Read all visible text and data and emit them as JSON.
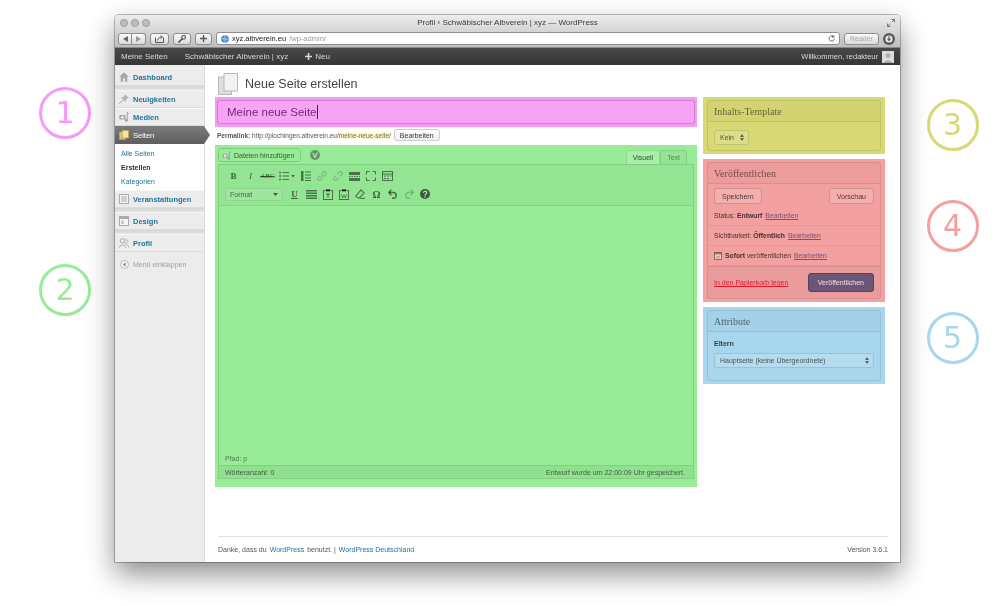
{
  "browser": {
    "title": "Profil ‹ Schwäbischer Albverein | xyz — WordPress",
    "url_host": "xyz.albverein.eu",
    "url_path": "/wp-admin/",
    "reader": {
      "label": "Reader",
      "disabled": true
    }
  },
  "admin_bar": {
    "items": [
      {
        "kind": "link",
        "label": "Meine Seiten"
      },
      {
        "kind": "link",
        "label": "Schwäbischer Albverein | xyz"
      },
      {
        "kind": "new",
        "label": "Neu"
      }
    ],
    "greeting": "Willkommen, redakteur"
  },
  "sidebar": {
    "groups": [
      [
        {
          "label": "Dashboard",
          "selected": false
        }
      ],
      [
        {
          "label": "Neuigkeiten",
          "selected": false
        },
        {
          "label": "Medien",
          "selected": false
        },
        {
          "label": "Seiten",
          "selected": true,
          "children": [
            {
              "label": "Alle Seiten",
              "selected": false
            },
            {
              "label": "Erstellen",
              "selected": true
            },
            {
              "label": "Kategorien",
              "selected": false
            }
          ]
        },
        {
          "label": "Veranstaltungen",
          "selected": false
        }
      ],
      [
        {
          "label": "Design",
          "selected": false
        }
      ],
      [
        {
          "label": "Profil",
          "selected": false
        }
      ]
    ],
    "collapse": "Menü einklappen"
  },
  "page": {
    "heading": "Neue Seite erstellen",
    "title_value": "Meine neue Seite",
    "permalink": {
      "text": "**Permalink:** http://plochingen.albverein.eu/",
      "slug": "meine-neue-seite/",
      "button": "Bearbeiten"
    }
  },
  "editor": {
    "add_media": "Dateien hinzufügen",
    "tabs": [
      {
        "label": "Visuell",
        "selected": true
      },
      {
        "label": "Text",
        "selected": false
      }
    ],
    "toolbar": [
      [
        {
          "kind": "glyph",
          "label": "B",
          "disabled": false
        },
        {
          "kind": "glyph",
          "label": "I",
          "disabled": false
        },
        {
          "kind": "glyph",
          "label": "ABC",
          "disabled": false
        },
        {
          "kind": "icon",
          "disabled": false
        },
        {
          "kind": "icon",
          "disabled": false
        },
        {
          "kind": "icon",
          "disabled": true
        },
        {
          "kind": "icon",
          "disabled": true
        },
        {
          "kind": "icon",
          "disabled": false
        },
        {
          "kind": "icon",
          "disabled": false
        },
        {
          "kind": "icon",
          "disabled": false
        }
      ],
      [
        {
          "kind": "select",
          "label": "Format",
          "disabled": false
        },
        {
          "kind": "glyph",
          "label": "U",
          "disabled": false
        },
        {
          "kind": "icon",
          "disabled": false
        },
        {
          "kind": "icon",
          "disabled": false
        },
        {
          "kind": "icon",
          "disabled": false
        },
        {
          "kind": "icon",
          "disabled": false
        },
        {
          "kind": "glyph",
          "label": "Ω",
          "disabled": false
        },
        {
          "kind": "icon",
          "disabled": false
        },
        {
          "kind": "icon",
          "disabled": true
        },
        {
          "kind": "icon",
          "disabled": false
        }
      ]
    ],
    "path": "Pfad: p",
    "word_count": "Wörteranzahl: 0",
    "autosave": "Entwurf wurde um 22:00:09 Uhr gespeichert."
  },
  "template_box": {
    "title": "Inhalts-Template",
    "select": "Kein"
  },
  "publish_box": {
    "title": "Veröffentlichen",
    "save": "Speichern",
    "preview": "Vorschau",
    "rows": [
      {
        "kind": "text",
        "text": "Status: **Entwurf**",
        "link": "Bearbeiten"
      },
      {
        "kind": "text",
        "text": "Sichtbarkeit: **Öffentlich**",
        "link": "Bearbeiten"
      },
      {
        "kind": "schedule",
        "text": "**Sofort** veröffentlichen",
        "link": "Bearbeiten"
      }
    ],
    "trash": "In den Papierkorb legen",
    "publish": "Veröffentlichen"
  },
  "attributes_box": {
    "title": "Attribute",
    "label": "Eltern",
    "select": "Hauptseite (keine Übergeordnete)"
  },
  "footer": {
    "parts": [
      {
        "kind": "text",
        "text": "Danke, dass du"
      },
      {
        "kind": "link",
        "text": "WordPress"
      },
      {
        "kind": "text",
        "text": "benutzt. |"
      },
      {
        "kind": "link",
        "text": "WordPress Deutschland"
      }
    ],
    "version": "Version 3.6.1"
  },
  "callouts": [
    {
      "label": "1",
      "color": "#f79af7"
    },
    {
      "label": "2",
      "color": "#98ec98"
    },
    {
      "label": "3",
      "color": "#d8d874"
    },
    {
      "label": "4",
      "color": "#f2a0a0"
    },
    {
      "label": "5",
      "color": "#a8d6ec"
    }
  ]
}
